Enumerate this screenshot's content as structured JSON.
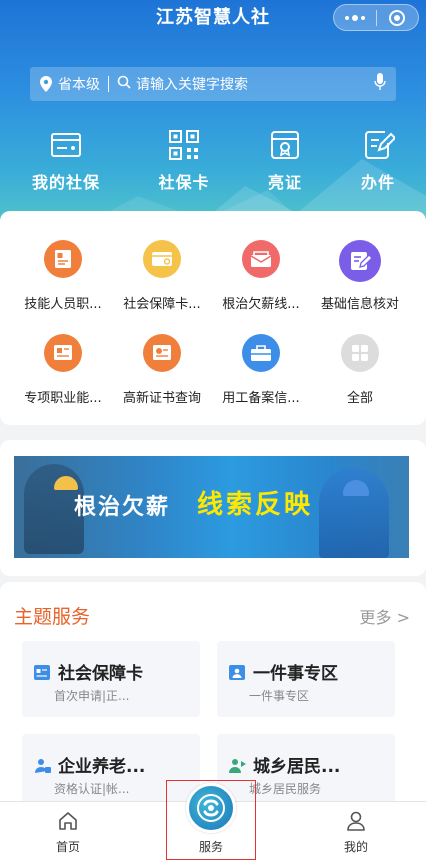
{
  "header": {
    "title": "江苏智慧人社"
  },
  "search": {
    "region": "省本级",
    "placeholder": "请输入关键字搜索"
  },
  "quick_actions": [
    {
      "label": "我的社保",
      "icon": "card-icon"
    },
    {
      "label": "社保卡",
      "icon": "qrcode-icon"
    },
    {
      "label": "亮证",
      "icon": "certificate-icon"
    },
    {
      "label": "办件",
      "icon": "edit-document-icon"
    }
  ],
  "services": [
    {
      "label": "技能人员职...",
      "icon": "certificate-icon",
      "color": "#f07f3c"
    },
    {
      "label": "社会保障卡...",
      "icon": "card-icon",
      "color": "#f5c34a"
    },
    {
      "label": "根治欠薪线...",
      "icon": "envelope-icon",
      "color": "#f16a6a"
    },
    {
      "label": "基础信息核对",
      "icon": "edit-icon",
      "color": "#7b5ee8"
    },
    {
      "label": "专项职业能...",
      "icon": "certificate-icon",
      "color": "#f07f3c"
    },
    {
      "label": "高新证书查询",
      "icon": "certificate-icon",
      "color": "#f07f3c"
    },
    {
      "label": "用工备案信...",
      "icon": "briefcase-icon",
      "color": "#3d8ee8"
    },
    {
      "label": "全部",
      "icon": "grid-icon",
      "color": "#dcdcdc"
    }
  ],
  "banner": {
    "text_white": "根治欠薪",
    "text_yellow": "线索反映"
  },
  "themes": {
    "title": "主题服务",
    "more": "更多 >",
    "items": [
      {
        "title": "社会保障卡",
        "sub": "首次申请|正...",
        "icon": "id-card-icon"
      },
      {
        "title": "一件事专区",
        "sub": "一件事专区",
        "icon": "person-badge-icon"
      },
      {
        "title": "企业养老...",
        "sub": "资格认证|帐...",
        "icon": "pension-icon"
      },
      {
        "title": "城乡居民...",
        "sub": "城乡居民服务",
        "icon": "resident-icon"
      }
    ]
  },
  "tabbar": {
    "home": "首页",
    "service": "服务",
    "mine": "我的"
  },
  "colors": {
    "accent": "#e8622a",
    "primary": "#2d8fe0"
  }
}
